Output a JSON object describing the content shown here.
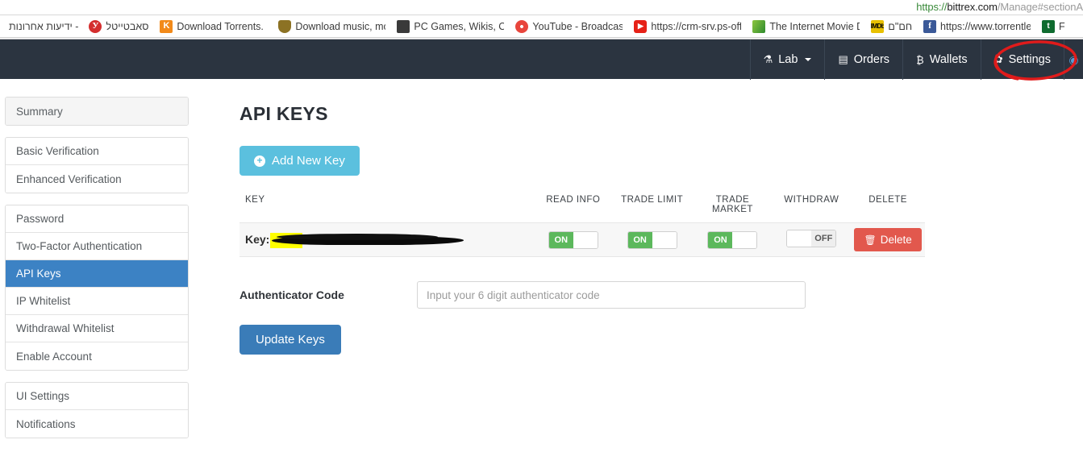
{
  "browser": {
    "status_url": {
      "scheme": "https://",
      "host": "bittrex.com",
      "path": "/Manage#sectionA"
    },
    "bookmarks": [
      {
        "label": "ידיעות אחרונות -",
        "icon": "none-icon",
        "icon_glyph": "",
        "icon_class": "ico-none"
      },
      {
        "label": "סאבטייטל",
        "icon": "yandex-icon",
        "icon_glyph": "У",
        "icon_class": "ico-yandex"
      },
      {
        "label": "Download Torrents. F",
        "icon": "kickass-torrents-icon",
        "icon_glyph": "K",
        "icon_class": "ico-kat"
      },
      {
        "label": "Download music, mo",
        "icon": "shield-icon",
        "icon_glyph": "",
        "icon_class": "ico-shield"
      },
      {
        "label": "PC Games, Wikis, Che",
        "icon": "console-icon",
        "icon_glyph": "",
        "icon_class": "ico-bench"
      },
      {
        "label": "YouTube - Broadcast",
        "icon": "chrome-icon",
        "icon_glyph": "",
        "icon_class": "ico-chrome"
      },
      {
        "label": "https://crm-srv.ps-off",
        "icon": "youtube-icon",
        "icon_glyph": "▶",
        "icon_class": "ico-yt"
      },
      {
        "label": "The Internet Movie D",
        "icon": "chart-icon",
        "icon_glyph": "",
        "icon_class": "ico-chart"
      },
      {
        "label": "חם\"ם",
        "icon": "imdb-icon",
        "icon_glyph": "IMDb",
        "icon_class": "ico-imdb"
      },
      {
        "label": "https://www.torrentle",
        "icon": "facebook-icon",
        "icon_glyph": "f",
        "icon_class": "ico-fb"
      },
      {
        "label": "F",
        "icon": "torrentleech-icon",
        "icon_glyph": "t",
        "icon_class": "ico-tl"
      }
    ]
  },
  "navbar": {
    "items": [
      {
        "label": "Lab",
        "icon": "flask-icon",
        "icon_glyph": "⚗",
        "caret": true
      },
      {
        "label": "Orders",
        "icon": "calendar-icon",
        "icon_glyph": "▤",
        "caret": false
      },
      {
        "label": "Wallets",
        "icon": "bitcoin-icon",
        "icon_glyph": "₿",
        "caret": false
      },
      {
        "label": "Settings",
        "icon": "gear-icon",
        "icon_glyph": "✿",
        "caret": false
      }
    ],
    "partial_item_glyph": "◉",
    "annotation_color": "#e01b1b"
  },
  "sidebar": {
    "groups": [
      {
        "items": [
          {
            "label": "Summary",
            "state": "muted"
          }
        ]
      },
      {
        "items": [
          {
            "label": "Basic Verification",
            "state": "normal"
          },
          {
            "label": "Enhanced Verification",
            "state": "normal"
          }
        ]
      },
      {
        "items": [
          {
            "label": "Password",
            "state": "normal"
          },
          {
            "label": "Two-Factor Authentication",
            "state": "normal"
          },
          {
            "label": "API Keys",
            "state": "active"
          },
          {
            "label": "IP Whitelist",
            "state": "normal"
          },
          {
            "label": "Withdrawal Whitelist",
            "state": "normal"
          },
          {
            "label": "Enable Account",
            "state": "normal"
          }
        ]
      },
      {
        "items": [
          {
            "label": "UI Settings",
            "state": "normal"
          },
          {
            "label": "Notifications",
            "state": "normal"
          }
        ]
      }
    ]
  },
  "main": {
    "title": "API KEYS",
    "add_new_key_label": "Add New Key",
    "add_new_key_icon_glyph": "+",
    "table": {
      "headers": {
        "key": "KEY",
        "read_info": "READ INFO",
        "trade_limit": "TRADE LIMIT",
        "trade_market_line1": "TRADE",
        "trade_market_line2": "MARKET",
        "withdraw": "WITHDRAW",
        "delete": "DELETE"
      },
      "rows": [
        {
          "key_label": "Key:",
          "key_value_redacted": true,
          "read_info": "ON",
          "trade_limit": "ON",
          "trade_market": "ON",
          "withdraw": "OFF",
          "delete_label": "Delete",
          "delete_icon_glyph": "🗑"
        }
      ],
      "toggle_on_label": "ON",
      "toggle_off_label": "OFF"
    },
    "auth_label": "Authenticator Code",
    "auth_placeholder": "Input your 6 digit authenticator code",
    "auth_value": "",
    "update_keys_label": "Update Keys"
  },
  "colors": {
    "navbar_bg": "#2b3440",
    "sidebar_active": "#3c82c4",
    "add_key_button": "#5bc0de",
    "update_button": "#3a7cb8",
    "delete_button": "#e2584d",
    "toggle_on": "#5cb85c",
    "annotation_red": "#e01b1b",
    "highlight_yellow": "#ffff00"
  }
}
